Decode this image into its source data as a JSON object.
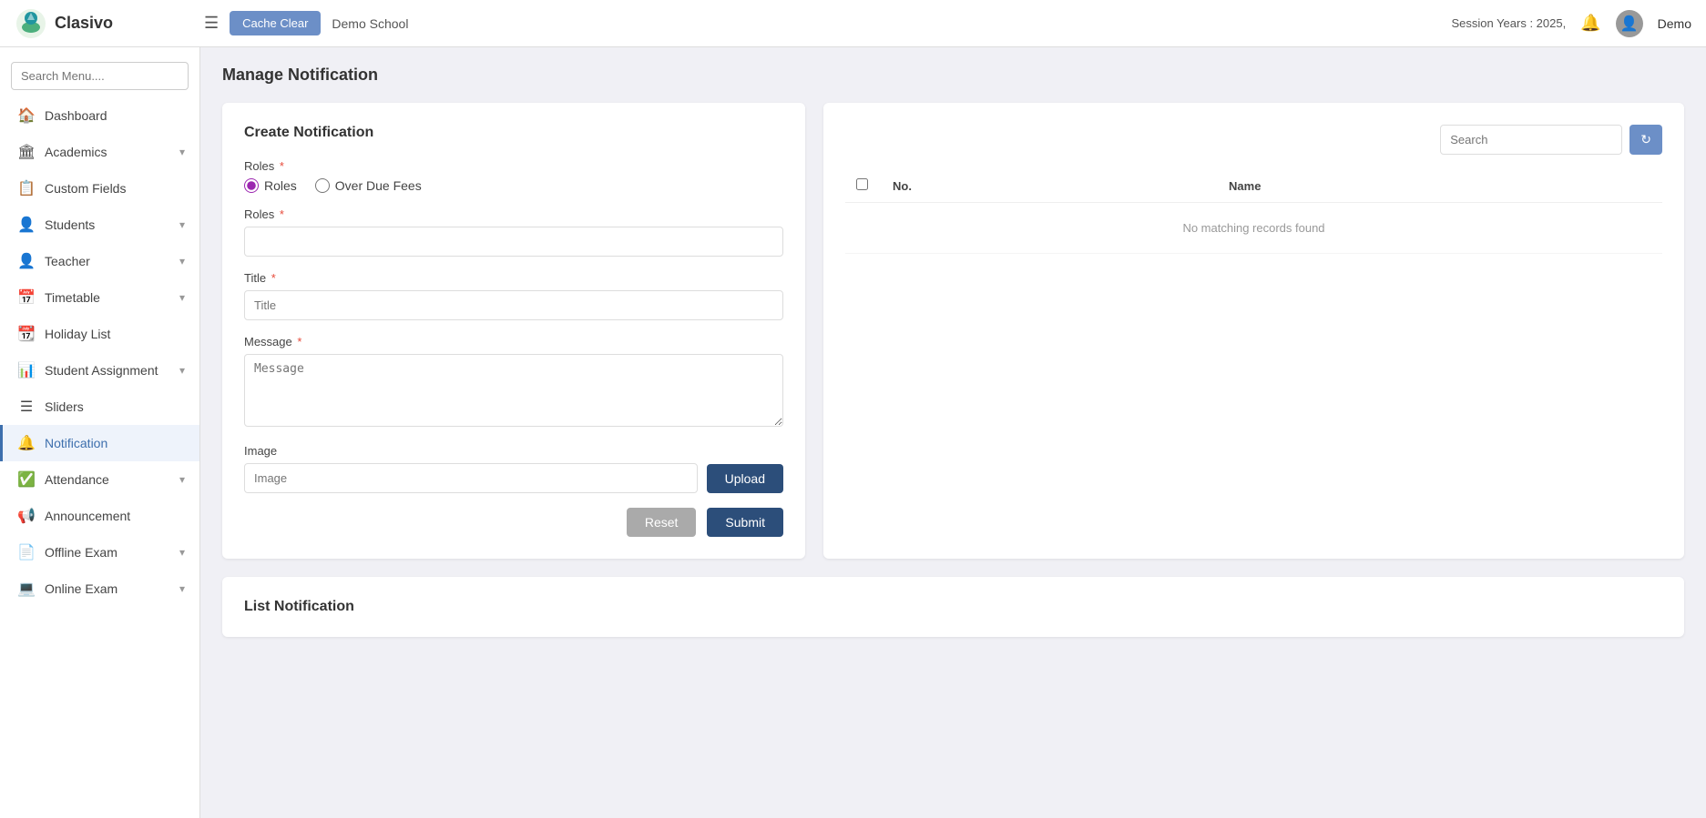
{
  "navbar": {
    "logo_text": "Clasivo",
    "cache_clear_label": "Cache Clear",
    "school_name": "Demo School",
    "session_label": "Session Years : 2025,",
    "username": "Demo"
  },
  "sidebar": {
    "search_placeholder": "Search Menu....",
    "items": [
      {
        "id": "dashboard",
        "label": "Dashboard",
        "icon": "🏠",
        "has_chevron": false
      },
      {
        "id": "academics",
        "label": "Academics",
        "icon": "🏛",
        "has_chevron": true
      },
      {
        "id": "custom-fields",
        "label": "Custom Fields",
        "icon": "📋",
        "has_chevron": false
      },
      {
        "id": "students",
        "label": "Students",
        "icon": "👤",
        "has_chevron": true
      },
      {
        "id": "teacher",
        "label": "Teacher",
        "icon": "👤",
        "has_chevron": true
      },
      {
        "id": "timetable",
        "label": "Timetable",
        "icon": "📅",
        "has_chevron": true
      },
      {
        "id": "holiday-list",
        "label": "Holiday List",
        "icon": "📆",
        "has_chevron": false
      },
      {
        "id": "student-assignment",
        "label": "Student Assignment",
        "icon": "📊",
        "has_chevron": true
      },
      {
        "id": "sliders",
        "label": "Sliders",
        "icon": "☰",
        "has_chevron": false
      },
      {
        "id": "notification",
        "label": "Notification",
        "icon": "🔔",
        "has_chevron": false,
        "active": true
      },
      {
        "id": "attendance",
        "label": "Attendance",
        "icon": "✅",
        "has_chevron": true
      },
      {
        "id": "announcement",
        "label": "Announcement",
        "icon": "📢",
        "has_chevron": false
      },
      {
        "id": "offline-exam",
        "label": "Offline Exam",
        "icon": "📄",
        "has_chevron": true
      },
      {
        "id": "online-exam",
        "label": "Online Exam",
        "icon": "💻",
        "has_chevron": true
      }
    ]
  },
  "page": {
    "title": "Manage Notification"
  },
  "create_notification": {
    "panel_title": "Create Notification",
    "roles_label": "Roles",
    "radio_roles": "Roles",
    "radio_overdue": "Over Due Fees",
    "roles_field_label": "Roles",
    "title_label": "Title",
    "title_placeholder": "Title",
    "message_label": "Message",
    "message_placeholder": "Message",
    "image_label": "Image",
    "image_placeholder": "Image",
    "upload_label": "Upload",
    "reset_label": "Reset",
    "submit_label": "Submit"
  },
  "right_panel": {
    "search_placeholder": "Search",
    "refresh_icon": "↻",
    "table": {
      "col_checkbox": "",
      "col_no": "No.",
      "col_name": "Name",
      "no_data_message": "No matching records found"
    }
  },
  "list_notification": {
    "panel_title": "List Notification"
  }
}
